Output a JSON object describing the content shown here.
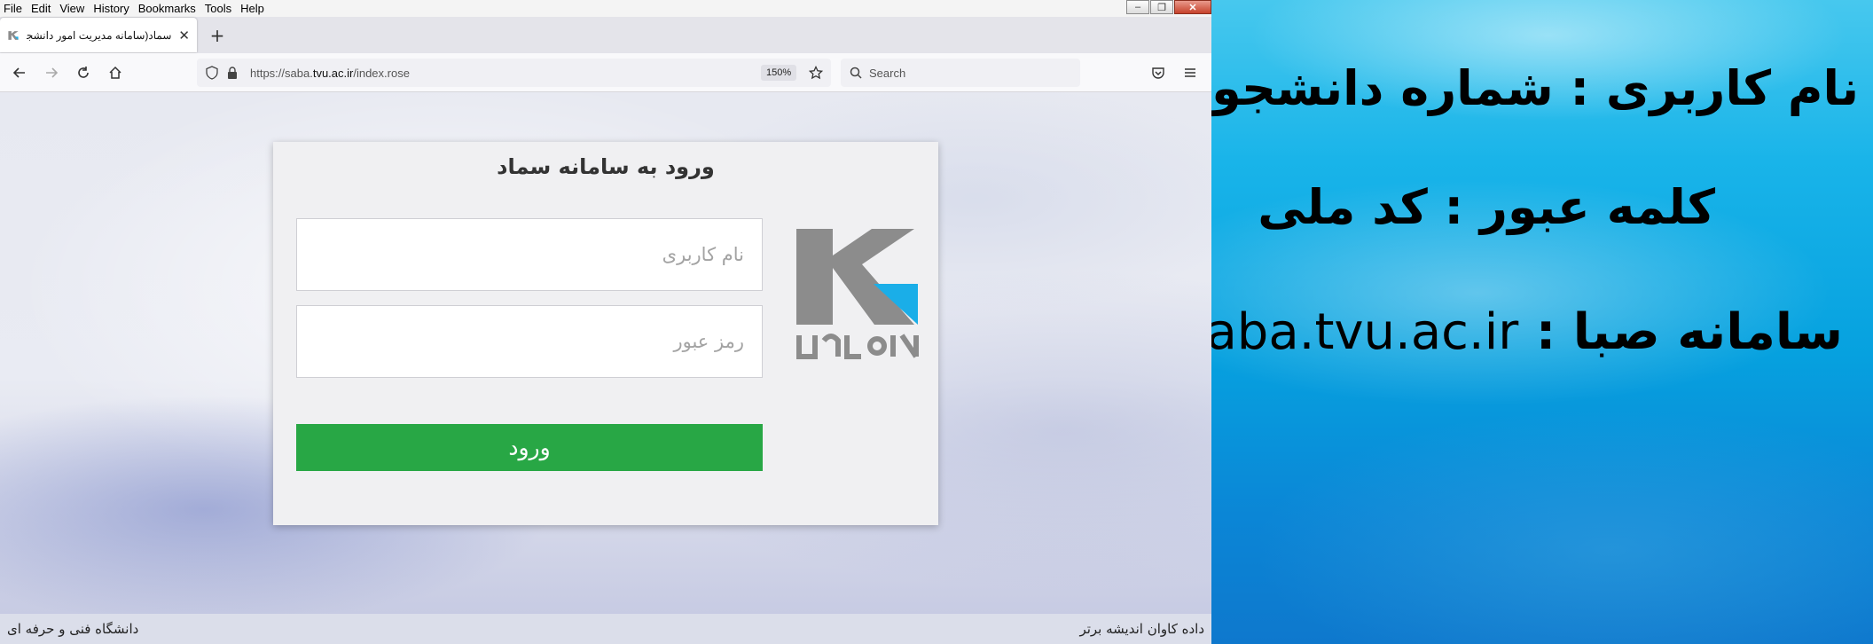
{
  "browser": {
    "menu": [
      "File",
      "Edit",
      "View",
      "History",
      "Bookmarks",
      "Tools",
      "Help"
    ],
    "tab": {
      "title": "سماد(سامانه مدیریت امور دانشجو..."
    },
    "url": {
      "prefix": "https://saba.",
      "domain": "tvu.ac.ir",
      "path": "/index.rose"
    },
    "zoom": "150%",
    "search_placeholder": "Search"
  },
  "login": {
    "title": "ورود به سامانه سماد",
    "username_placeholder": "نام کاربری",
    "password_placeholder": "رمز عبور",
    "submit_label": "ورود",
    "logo_text": "دادہ کاوان"
  },
  "footer": {
    "left": "دانشگاه فنی و حرفه ای",
    "right": "داده کاوان اندیشه برتر"
  },
  "info_panel": {
    "username_line": "نام کاربری : شماره دانشجویی",
    "password_line": "کلمه عبور : کد ملی",
    "site_label": "سامانه صبا : ",
    "site_url": "saba.tvu.ac.ir"
  },
  "colors": {
    "login_button": "#28a745",
    "logo_gray": "#8c8c8c",
    "logo_blue": "#1aaee8",
    "panel_blue": "#06a1df"
  }
}
